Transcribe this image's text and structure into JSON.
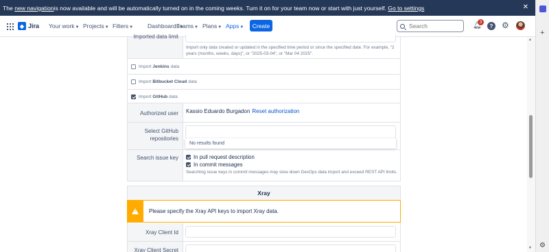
{
  "banner": {
    "text_prefix": "The ",
    "link_new_navigation": "new navigation",
    "text_middle": " is now available and will be automatically turned on in the coming weeks. Turn it on for your team now or start with just yourself. ",
    "link_settings": "Go to settings",
    "close_glyph": "✕"
  },
  "nav": {
    "logo": "Jira",
    "items": [
      "Your work",
      "Projects",
      "Filters",
      "Dashboards",
      "Teams",
      "Plans",
      "Apps"
    ],
    "create_label": "Create",
    "search_placeholder": "Search",
    "notification_count": "3",
    "help_glyph": "?"
  },
  "form": {
    "imported_data_limit_label": "Imported data limit",
    "imported_data_limit_help": "Import only data created or updated in the specified time period or since the specified date. For example, \"2 years (months, weeks, days)\", or \"2025-03-04\", or \"Mar 04 2025\".",
    "import_jenkins": {
      "prefix": "Import",
      "name": "Jenkins",
      "suffix": "data",
      "checked": false
    },
    "import_bitbucket": {
      "prefix": "Import",
      "name": "Bitbucket Cloud",
      "suffix": "data",
      "checked": false
    },
    "import_github": {
      "prefix": "Import",
      "name": "GitHub",
      "suffix": "data",
      "checked": true
    },
    "authorized_user_label": "Authorized user",
    "authorized_user_name": "Kassio Eduardo Burgadon",
    "reset_authorization": "Reset authorization",
    "select_repos_label_line1": "Select GitHub",
    "select_repos_label_line2": "repositories",
    "no_results": "No results found",
    "search_issue_key_label": "Search issue key",
    "in_pull_request": "In pull request description",
    "in_commit_messages": "In commit messages",
    "search_issue_help": "Searching issue keys in commit messages may slow down DevOps data import and exceed REST API limits."
  },
  "xray": {
    "title": "Xray",
    "warning": "Please specify the Xray API keys to import Xray data.",
    "client_id_label": "Xray Client Id",
    "client_secret_label": "Xray Client Secret"
  }
}
